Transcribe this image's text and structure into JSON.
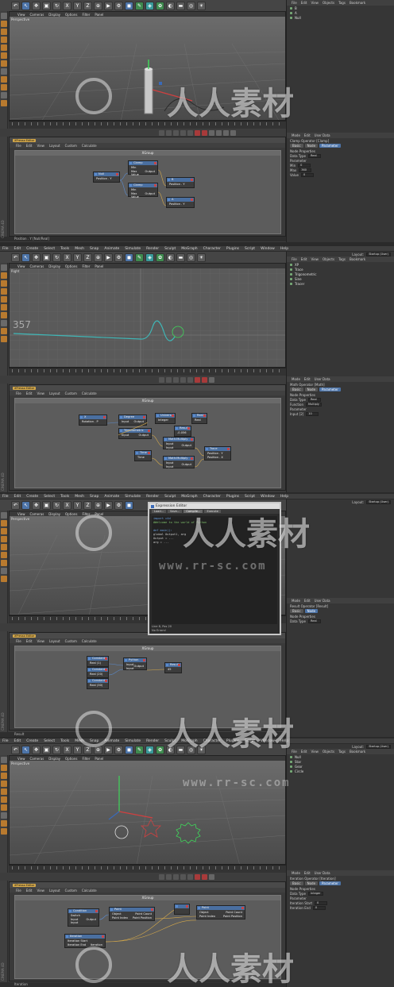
{
  "menus": {
    "main": [
      "File",
      "Edit",
      "Create",
      "Select",
      "Tools",
      "Mesh",
      "Snap",
      "Animate",
      "Simulate",
      "Render",
      "Sculpt",
      "MoGraph",
      "Character",
      "Plugins",
      "Script",
      "Window",
      "Help"
    ],
    "viewport": [
      "View",
      "Cameras",
      "Display",
      "Options",
      "Filter",
      "Panel"
    ],
    "xpresso": [
      "File",
      "Edit",
      "View",
      "Layout",
      "Custom",
      "Calculate"
    ],
    "objects_tabs": [
      "File",
      "Edit",
      "View",
      "Objects",
      "Tags",
      "Bookmark"
    ],
    "attr_tabs": [
      "Mode",
      "Edit",
      "User Data"
    ]
  },
  "layout_label": "Layout:",
  "layout_value": "Startup (User)",
  "viewport_perspective": "Perspective",
  "viewport_right": "Right",
  "xgroup_title": "XGroup",
  "xpresso_editor_label": "XPresso Editor",
  "brand": "CINEMA 4D",
  "panel1": {
    "nodes": {
      "null": {
        "title": "Null",
        "rows": [
          "Position . Y"
        ]
      },
      "clamp1": {
        "title": "Clamp",
        "rows": [
          "Min",
          "Max",
          "Value",
          "Output"
        ]
      },
      "clamp2": {
        "title": "Clamp",
        "rows": [
          "Min",
          "Max",
          "Value",
          "Output"
        ]
      },
      "out1": {
        "title": "B",
        "rows": [
          "Position . Y"
        ]
      },
      "out2": {
        "title": "A",
        "rows": [
          "Position . Y"
        ]
      }
    },
    "attr_title": "Clamp Operator [Clamp]",
    "tabs": [
      "Basic",
      "Node",
      "Parameter"
    ],
    "props": [
      "Node Properties",
      "Data Type",
      "Parameter",
      "Min",
      "Max",
      "Value"
    ],
    "data_type_value": "Real",
    "min_value": "0",
    "max_value": "360",
    "value_value": "0",
    "status": "Position . Y [Null/Real]",
    "objects": [
      "B",
      "A",
      "Null"
    ]
  },
  "panel2": {
    "number": "357",
    "nodes": {
      "x": {
        "title": "X",
        "rows": [
          "Rotation . P"
        ]
      },
      "degree": {
        "title": "Degree",
        "rows": [
          "Input",
          "Output"
        ]
      },
      "universal": {
        "title": "Universal",
        "rows": [
          "Integer"
        ]
      },
      "real": {
        "title": "Real",
        "rows": [
          "Real"
        ]
      },
      "trig": {
        "title": "Trigonometric",
        "rows": [
          "Input",
          "Output"
        ]
      },
      "result": {
        "title": "Result",
        "rows": [
          "-0.056"
        ]
      },
      "math1": {
        "title": "Math:Multiply",
        "rows": [
          "Input",
          "Input",
          "Output"
        ]
      },
      "math2": {
        "title": "Math:Multiply",
        "rows": [
          "Input",
          "Input",
          "Output"
        ]
      },
      "trace": {
        "title": "Trace",
        "rows": [
          "Position . Y",
          "Position . X"
        ]
      },
      "time": {
        "title": "Time",
        "rows": [
          "Time"
        ]
      }
    },
    "attr_title": "Math Operator [Math]",
    "tabs": [
      "Basic",
      "Node",
      "Parameter"
    ],
    "props": [
      "Node Properties",
      "Data Type",
      "Function",
      "Parameter",
      "Input [2]"
    ],
    "data_type_value": "Real",
    "function_value": "Multiply",
    "input_value": "10",
    "objects": [
      "XP",
      "Trace",
      "Trigonometric",
      "Sine",
      "Tracer"
    ]
  },
  "panel3": {
    "expr_title": "Expression Editor",
    "expr_tabs": [
      "Load...",
      "Save...",
      "Compile...",
      "Execute"
    ],
    "code": [
      "import c4d",
      "#Welcome to the world of Python",
      "",
      "def main():",
      "    global Output1, arg",
      "    Output = ...",
      "    arg = ..."
    ],
    "expr_status": [
      "Line 8, Pos 20",
      "No Errors!"
    ],
    "nodes": {
      "c1": {
        "title": "Constant",
        "rows": [
          "Real (1)"
        ]
      },
      "c2": {
        "title": "Constant",
        "rows": [
          "Real (20)"
        ]
      },
      "c3": {
        "title": "Constant",
        "rows": [
          "Real (30)"
        ]
      },
      "python": {
        "title": "Python",
        "rows": [
          "Input",
          "Input",
          "Output"
        ]
      },
      "result": {
        "title": "Result",
        "rows": [
          "45"
        ]
      }
    },
    "attr_title": "Result Operator [Result]",
    "tabs": [
      "Basic",
      "Node"
    ],
    "props": [
      "Node Properties",
      "Data Type"
    ],
    "data_type_value": "Real",
    "status": "Result"
  },
  "panel4": {
    "nodes": {
      "condition": {
        "title": "Condition",
        "rows": [
          "Switch",
          "Input",
          "Output",
          "Input"
        ]
      },
      "point1": {
        "title": "Point",
        "rows": [
          "Object",
          "Point Count",
          "Point Index",
          "Point Position"
        ]
      },
      "point2": {
        "title": "Point",
        "rows": [
          "Object",
          "Point Count",
          "Point Index",
          "Point Position"
        ]
      },
      "iteration": {
        "title": "Iteration",
        "rows": [
          "Iteration Start",
          "Iteration End",
          "Iteration"
        ]
      },
      "small": {
        "title": "",
        "rows": [
          ""
        ]
      }
    },
    "attr_title": "Iteration Operator [Iteration]",
    "tabs": [
      "Basic",
      "Node",
      "Parameter"
    ],
    "props": [
      "Node Properties",
      "Data Type",
      "Parameter",
      "Iteration Start",
      "Iteration End"
    ],
    "data_type_value": "Integer",
    "start_value": "0",
    "end_value": "0",
    "status": "Iteration",
    "objects": [
      "Null",
      "Star",
      "Gear",
      "Circle"
    ]
  },
  "watermark": {
    "text": "人人素材",
    "url": "www.rr-sc.com"
  },
  "colors": {
    "accent": "#4d74a8",
    "bg": "#3b3b3b",
    "curve": "#3fb6b6",
    "spline_green": "#3fd65a",
    "spline_red": "#d04040"
  }
}
